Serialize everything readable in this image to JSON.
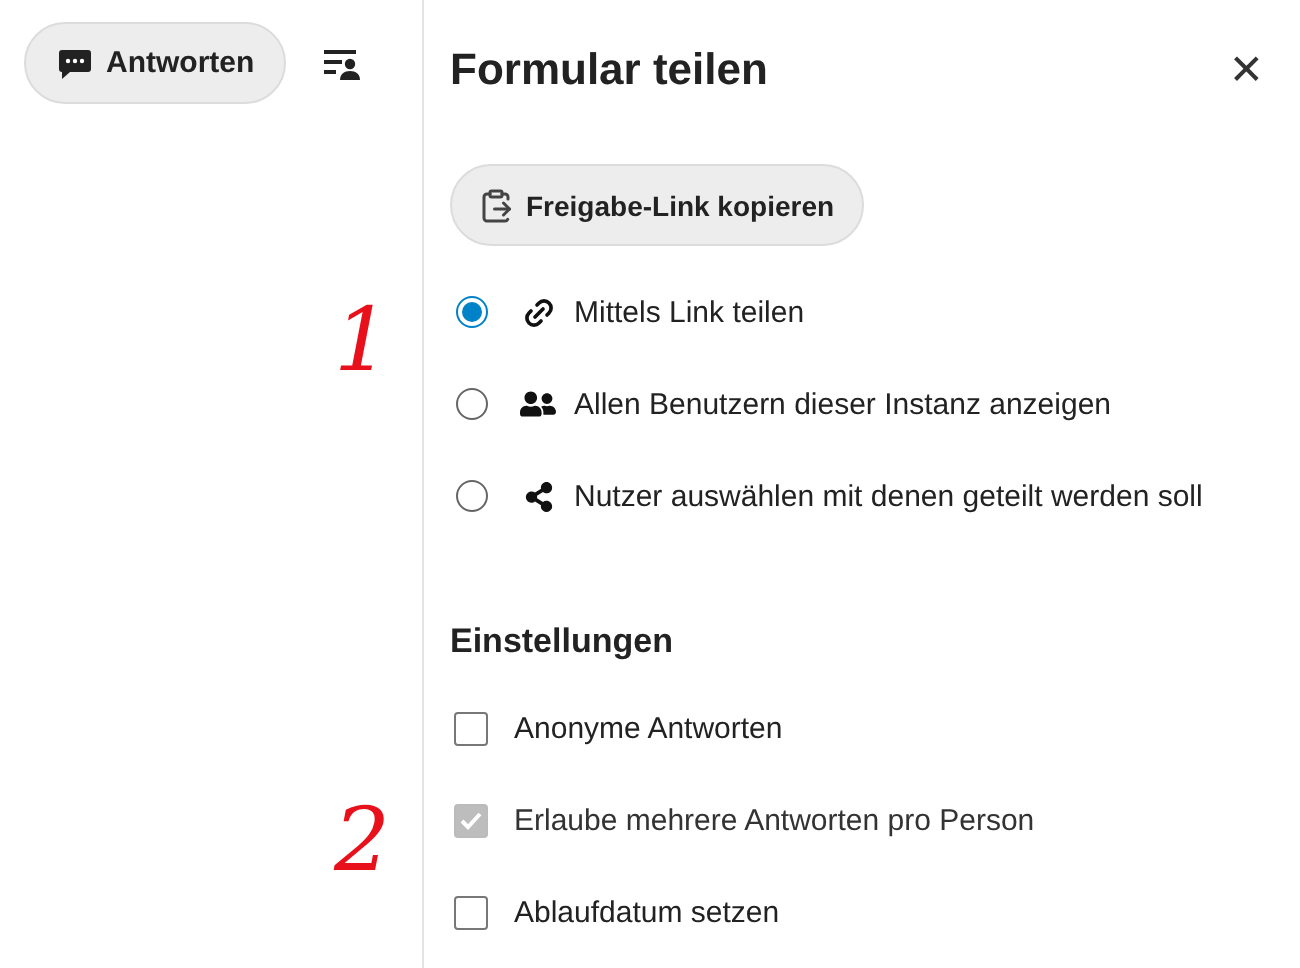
{
  "sidebar": {
    "responses_button": "Antworten"
  },
  "panel": {
    "title": "Formular teilen",
    "close": "✕",
    "copy_button": "Freigabe-Link kopieren",
    "share_options": [
      {
        "label": "Mittels Link teilen",
        "kind": "link",
        "selected": true
      },
      {
        "label": "Allen Benutzern dieser Instanz anzeigen",
        "kind": "users",
        "selected": false
      },
      {
        "label": "Nutzer auswählen mit denen geteilt werden soll",
        "kind": "share",
        "selected": false
      }
    ],
    "share_annotation": "1",
    "settings_heading": "Einstellungen",
    "settings": [
      {
        "label": "Anonyme Antworten",
        "checked": false,
        "disabled": false
      },
      {
        "label": "Erlaube mehrere Antworten pro Person",
        "checked": true,
        "disabled": true
      },
      {
        "label": "Ablaufdatum setzen",
        "checked": false,
        "disabled": false
      }
    ],
    "settings_annotation": "2"
  }
}
